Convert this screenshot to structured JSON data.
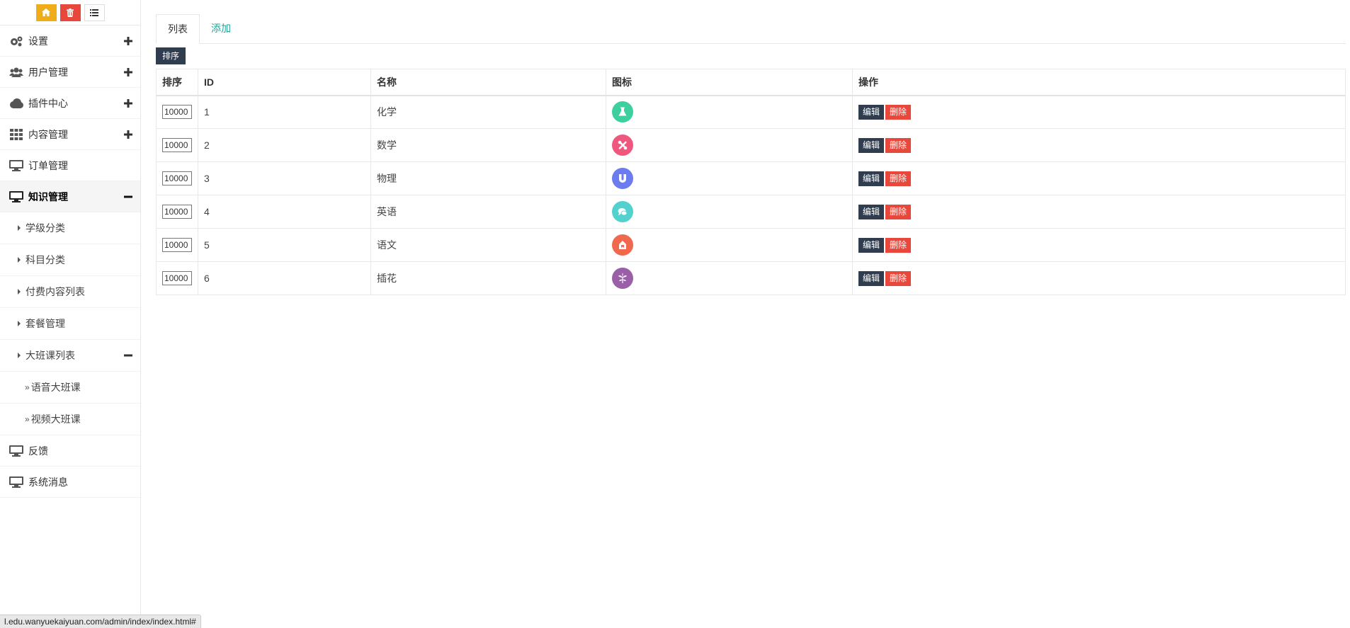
{
  "sidebar": {
    "top_buttons": [
      {
        "icon": "home-icon",
        "color": "#f0ad1a"
      },
      {
        "icon": "trash-icon",
        "color": "#e8473b"
      },
      {
        "icon": "list-icon",
        "color": "#ffffff"
      }
    ],
    "menu": [
      {
        "label": "设置",
        "icon": "gears-icon",
        "toggle": "plus"
      },
      {
        "label": "用户管理",
        "icon": "users-icon",
        "toggle": "plus"
      },
      {
        "label": "插件中心",
        "icon": "cloud-icon",
        "toggle": "plus"
      },
      {
        "label": "内容管理",
        "icon": "grid-icon",
        "toggle": "plus"
      },
      {
        "label": "订单管理",
        "icon": "monitor-icon",
        "toggle": ""
      },
      {
        "label": "知识管理",
        "icon": "monitor-icon",
        "toggle": "minus",
        "active": true
      },
      {
        "label": "反馈",
        "icon": "monitor-icon",
        "toggle": ""
      },
      {
        "label": "系统消息",
        "icon": "monitor-icon",
        "toggle": ""
      }
    ],
    "submenu": [
      {
        "label": "学级分类"
      },
      {
        "label": "科目分类"
      },
      {
        "label": "付费内容列表"
      },
      {
        "label": "套餐管理"
      },
      {
        "label": "大班课列表",
        "toggle": "minus"
      }
    ],
    "subsubmenu": [
      {
        "prefix": "»",
        "label": "语音大班课"
      },
      {
        "prefix": "»",
        "label": "视频大班课"
      }
    ]
  },
  "tabs": [
    {
      "label": "列表",
      "active": true
    },
    {
      "label": "添加",
      "active": false
    }
  ],
  "sort_button": "排序",
  "table": {
    "headers": [
      "排序",
      "ID",
      "名称",
      "图标",
      "操作"
    ],
    "rows": [
      {
        "sort": "10000",
        "id": "1",
        "name": "化学",
        "icon": "flask-icon",
        "color": "#3ecf9e"
      },
      {
        "sort": "10000",
        "id": "2",
        "name": "数学",
        "icon": "tools-icon",
        "color": "#f0577e"
      },
      {
        "sort": "10000",
        "id": "3",
        "name": "物理",
        "icon": "magnet-icon",
        "color": "#6b7cf0"
      },
      {
        "sort": "10000",
        "id": "4",
        "name": "英语",
        "icon": "chat-icon",
        "color": "#52d1cf"
      },
      {
        "sort": "10000",
        "id": "5",
        "name": "语文",
        "icon": "bookmark-icon",
        "color": "#f0684e"
      },
      {
        "sort": "10000",
        "id": "6",
        "name": "插花",
        "icon": "flower-icon",
        "color": "#9b5fa8"
      }
    ],
    "edit_label": "编辑",
    "delete_label": "删除"
  },
  "status_url": "l.edu.wanyuekaiyuan.com/admin/index/index.html#"
}
